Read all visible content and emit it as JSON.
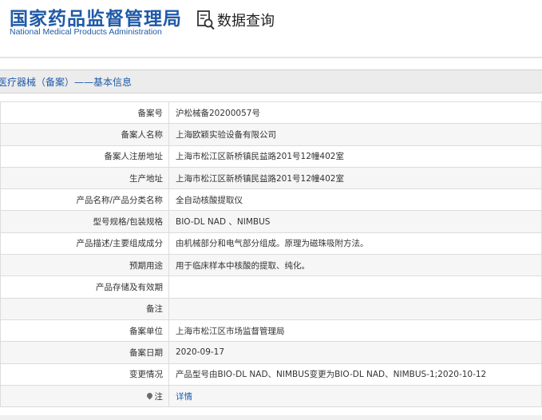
{
  "header": {
    "logo_cn": "国家药品监督管理局",
    "logo_en": "National Medical Products Administration",
    "query_icon": "search-document-icon",
    "query_title": "数据查询"
  },
  "page_title": "医疗器械（备案）——基本信息",
  "colors": {
    "brand_blue": "#1f5aa8",
    "row_alt": "#f6f6f6",
    "title_bg": "#ececec"
  },
  "rows": [
    {
      "label": "备案号",
      "value": "沪松械备20200057号"
    },
    {
      "label": "备案人名称",
      "value": "上海欧颖实验设备有限公司"
    },
    {
      "label": "备案人注册地址",
      "value": "上海市松江区新桥镇民益路201号12幢402室"
    },
    {
      "label": "生产地址",
      "value": "上海市松江区新桥镇民益路201号12幢402室"
    },
    {
      "label": "产品名称/产品分类名称",
      "value": "全自动核酸提取仪"
    },
    {
      "label": "型号规格/包装规格",
      "value": "BIO-DL NAD 、NIMBUS"
    },
    {
      "label": "产品描述/主要组成成分",
      "value": "由机械部分和电气部分组成。原理为磁珠吸附方法。"
    },
    {
      "label": "预期用途",
      "value": "用于临床样本中核酸的提取、纯化。"
    },
    {
      "label": "产品存储及有效期",
      "value": ""
    },
    {
      "label": "备注",
      "value": ""
    },
    {
      "label": "备案单位",
      "value": "上海市松江区市场监督管理局"
    },
    {
      "label": "备案日期",
      "value": "2020-09-17"
    },
    {
      "label": "变更情况",
      "value": "产品型号由BIO-DL NAD、NIMBUS变更为BIO-DL NAD、NIMBUS-1;2020-10-12"
    }
  ],
  "note_row": {
    "label": "注",
    "icon": "pin-icon",
    "link": "详情"
  }
}
